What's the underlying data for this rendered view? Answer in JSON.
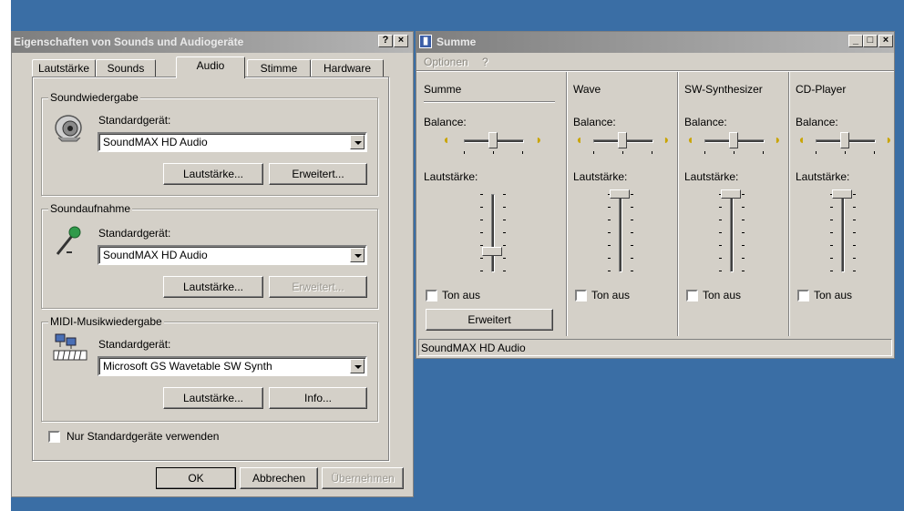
{
  "sound_dialog": {
    "title": "Eigenschaften von Sounds und Audiogeräte",
    "title_buttons": [
      "?",
      "×"
    ],
    "tabs": [
      "Lautstärke",
      "Sounds",
      "Audio",
      "Stimme",
      "Hardware"
    ],
    "active_tab": "Audio",
    "playback": {
      "group_title": "Soundwiedergabe",
      "device_label": "Standardgerät:",
      "device_value": "SoundMAX HD Audio",
      "volume_button": "Lautstärke...",
      "advanced_button": "Erweitert..."
    },
    "recording": {
      "group_title": "Soundaufnahme",
      "device_label": "Standardgerät:",
      "device_value": "SoundMAX HD Audio",
      "volume_button": "Lautstärke...",
      "advanced_button": "Erweitert..."
    },
    "midi": {
      "group_title": "MIDI-Musikwiedergabe",
      "device_label": "Standardgerät:",
      "device_value": "Microsoft GS Wavetable SW Synth",
      "volume_button": "Lautstärke...",
      "info_button": "Info..."
    },
    "only_default_label": "Nur Standardgeräte verwenden",
    "ok_button": "OK",
    "cancel_button": "Abbrechen",
    "apply_button": "Übernehmen"
  },
  "mixer": {
    "title": "Summe",
    "menu_options": "Optionen",
    "menu_help": "?",
    "title_buttons": [
      "_",
      "□",
      "×"
    ],
    "channels": [
      {
        "name": "Summe",
        "balance_label": "Balance:",
        "volume_label": "Lautstärke:",
        "mute_label": "Ton aus",
        "balance": 0.5,
        "volume": 0.25
      },
      {
        "name": "Wave",
        "balance_label": "Balance:",
        "volume_label": "Lautstärke:",
        "mute_label": "Ton aus",
        "balance": 0.5,
        "volume": 1.0
      },
      {
        "name": "SW-Synthesizer",
        "balance_label": "Balance:",
        "volume_label": "Lautstärke:",
        "mute_label": "Ton aus",
        "balance": 0.5,
        "volume": 1.0
      },
      {
        "name": "CD-Player",
        "balance_label": "Balance:",
        "volume_label": "Lautstärke:",
        "mute_label": "Ton aus",
        "balance": 0.5,
        "volume": 1.0
      }
    ],
    "advanced_button": "Erweitert",
    "status": "SoundMAX HD Audio"
  },
  "colors": {
    "desktop": "#3a6ea5",
    "window_face": "#d4d0c8",
    "inactive_title": "#808080"
  }
}
